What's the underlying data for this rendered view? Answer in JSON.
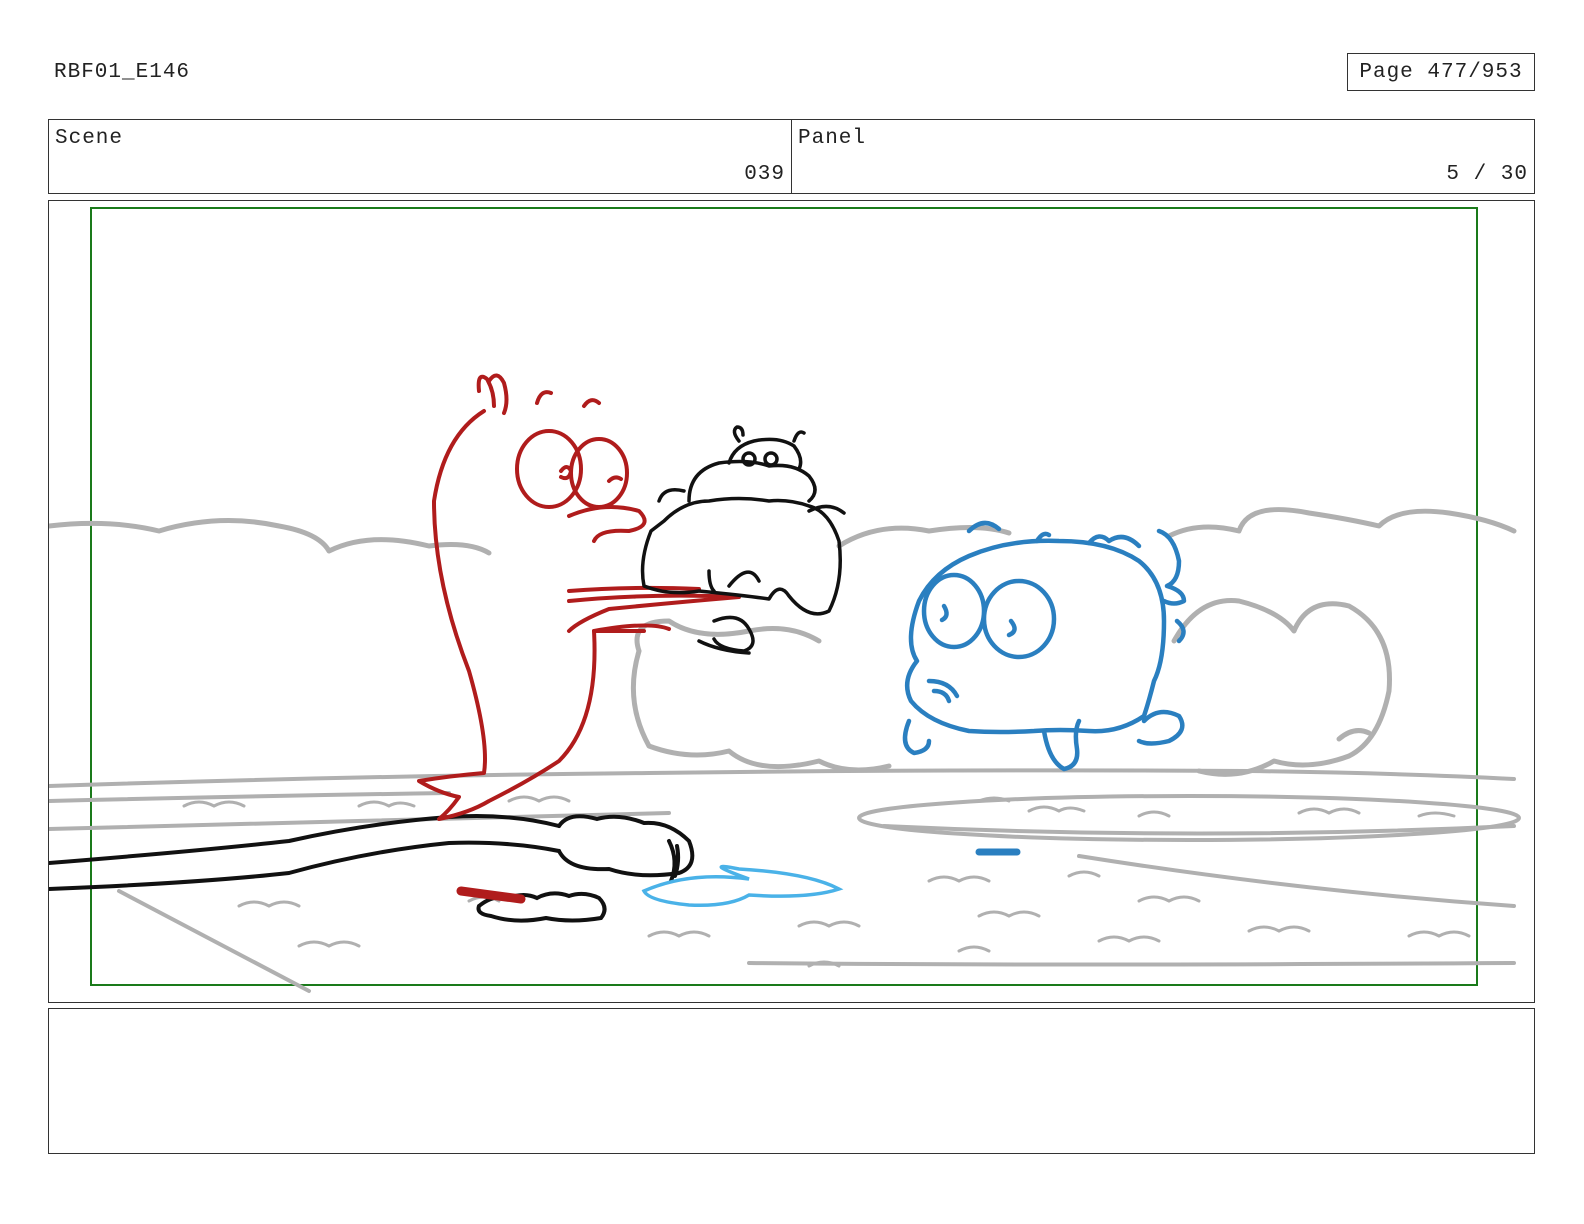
{
  "header": {
    "title": "RBF01_E146",
    "page_label": "Page 477/953"
  },
  "info": {
    "scene_label": "Scene",
    "scene_value": "039",
    "panel_label": "Panel",
    "panel_value": "5 / 30"
  },
  "notes": {
    "text": ""
  },
  "colors": {
    "border": "#333333",
    "safe_frame": "#1a7a1a",
    "background_lines": "#b0b0b0",
    "red_character": "#b01c1c",
    "blue_character": "#2a7fc0",
    "water": "#4ab2e8",
    "black_character": "#111111"
  }
}
